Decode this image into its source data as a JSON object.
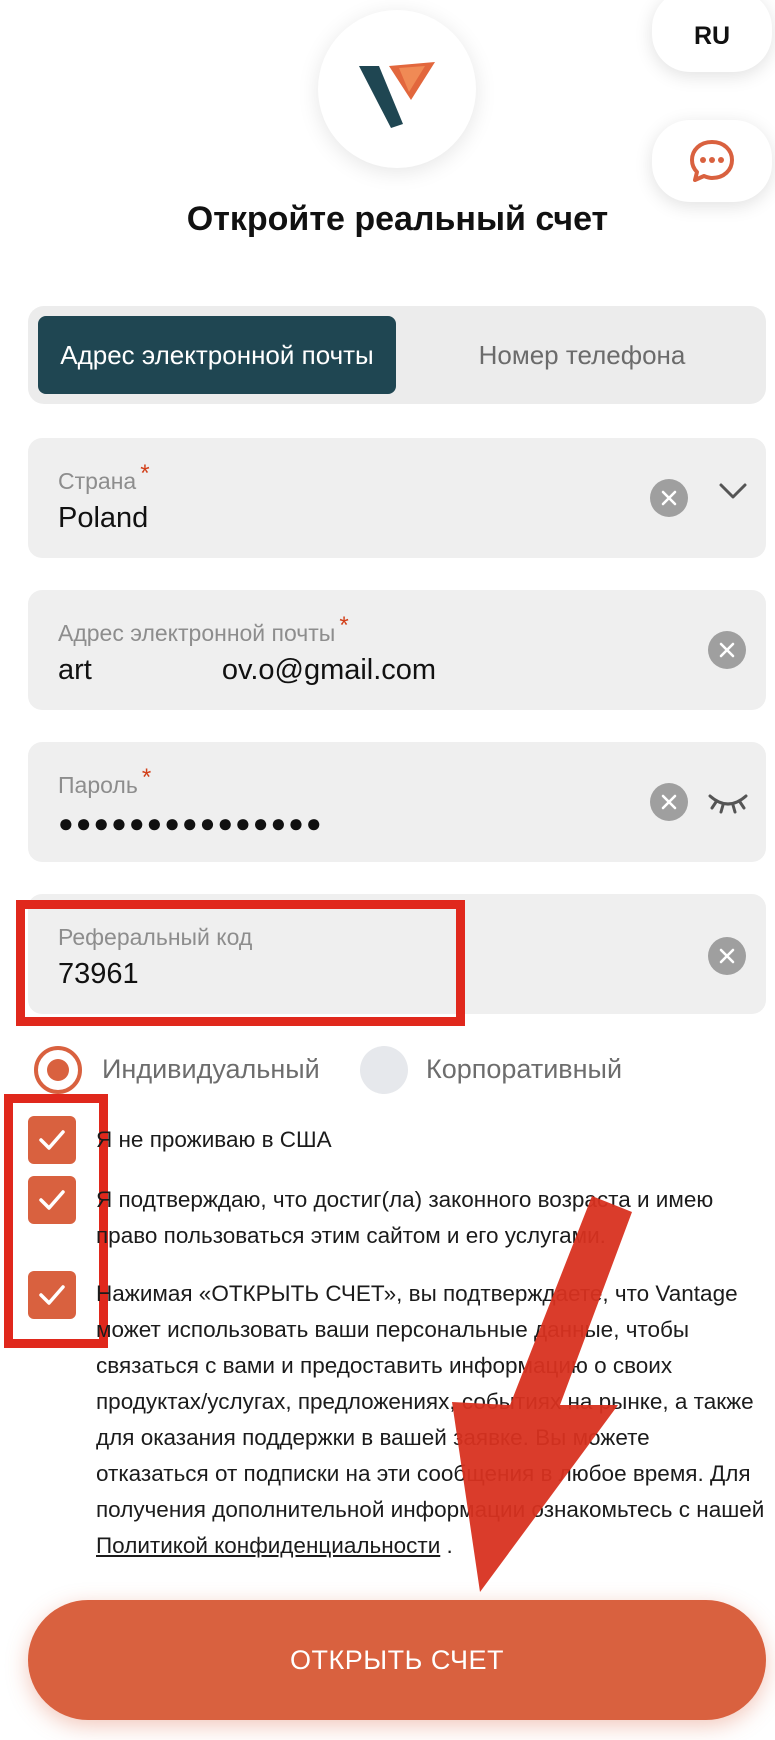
{
  "header": {
    "language": "RU",
    "title": "Откройте реальный счет"
  },
  "tabs": {
    "email": "Адрес электронной почты",
    "phone": "Номер телефона",
    "active": "email"
  },
  "fields": {
    "country": {
      "label": "Страна",
      "required": "*",
      "value": "Poland"
    },
    "email": {
      "label": "Адрес электронной почты",
      "required": "*",
      "value_prefix": "art",
      "value_suffix": "ov.o@gmail.com"
    },
    "password": {
      "label": "Пароль",
      "required": "*",
      "value": "●●●●●●●●●●●●●●●"
    },
    "referral": {
      "label": "Реферальный код",
      "value": "73961"
    }
  },
  "account_type": {
    "individual": "Индивидуальный",
    "corporate": "Корпоративный",
    "selected": "individual"
  },
  "consents": {
    "not_us": "Я не проживаю в США",
    "age": "Я подтверждаю, что достиг(ла) законного возраста и имею право пользоваться этим сайтом и его услугами.",
    "marketing": "Нажимая «ОТКРЫТЬ СЧЕТ», вы подтверждаете, что Vantage может использовать ваши персональные данные, чтобы связаться с вами и предоставить информацию о своих продуктах/услугах, предложениях, событиях на рынке, а также для оказания поддержки в вашей заявке. Вы можете отказаться от подписки на эти сообщения в любое время. Для получения дополнительной информации ознакомьтесь с нашей",
    "privacy_link": "Политикой конфиденциальности",
    "trailing": " ."
  },
  "submit_label": "ОТКРЫТЬ СЧЕТ",
  "colors": {
    "accent": "#d9613f",
    "tab_active": "#1f4652",
    "highlight": "#e0281c"
  },
  "icons": [
    "vantage-logo-icon",
    "chat-icon",
    "clear-icon",
    "chevron-down-icon",
    "eye-closed-icon",
    "check-icon"
  ]
}
